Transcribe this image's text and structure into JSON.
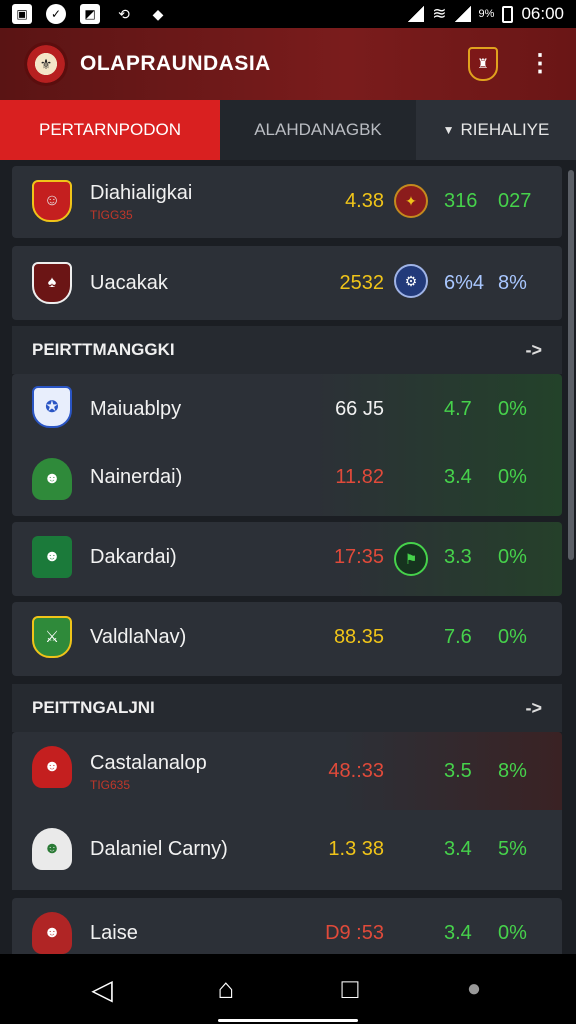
{
  "status": {
    "time": "06:00",
    "battery_pct": "9%"
  },
  "app": {
    "title": "OLAPRAUNDASIA"
  },
  "tabs": [
    {
      "label": "PERTARNPODON"
    },
    {
      "label": "ALAHDANAGBK"
    },
    {
      "label": "RIEHALIYE"
    }
  ],
  "rows_top": [
    {
      "name": "Diahialigkai",
      "sub": "TIGG35",
      "value": "4.38",
      "num": "316",
      "pct": "027"
    },
    {
      "name": "Uacakak",
      "sub": "",
      "value": "2532",
      "num": "6%4",
      "pct": "8%"
    }
  ],
  "section1": {
    "title": "PEIRTTMANGGKI",
    "arrow": "->"
  },
  "rows_s1": [
    {
      "name": "Maiuablpy",
      "sub": "",
      "value": "66 J5",
      "num": "4.7",
      "pct": "0%"
    },
    {
      "name": "Nainerdai)",
      "sub": "",
      "value": "11.82",
      "num": "3.4",
      "pct": "0%"
    },
    {
      "name": "Dakardai)",
      "sub": "",
      "value": "17:35",
      "num": "3.3",
      "pct": "0%"
    },
    {
      "name": "ValdlaNav)",
      "sub": "",
      "value": "88.35",
      "num": "7.6",
      "pct": "0%"
    }
  ],
  "section2": {
    "title": "PEITTNGALJNI",
    "arrow": "->"
  },
  "rows_s2": [
    {
      "name": "Castalanalop",
      "sub": "TIG635",
      "value": "48.:33",
      "num": "3.5",
      "pct": "8%"
    },
    {
      "name": "Dalaniel Carny)",
      "sub": "",
      "value": "1.3 38",
      "num": "3.4",
      "pct": "5%"
    },
    {
      "name": "Laise",
      "sub": "",
      "value": "D9 :53",
      "num": "3.4",
      "pct": "0%"
    }
  ],
  "colors": {
    "accent_red": "#d92020",
    "green": "#46d24b",
    "yellow": "#f0c419",
    "red_val": "#e04a3a"
  }
}
